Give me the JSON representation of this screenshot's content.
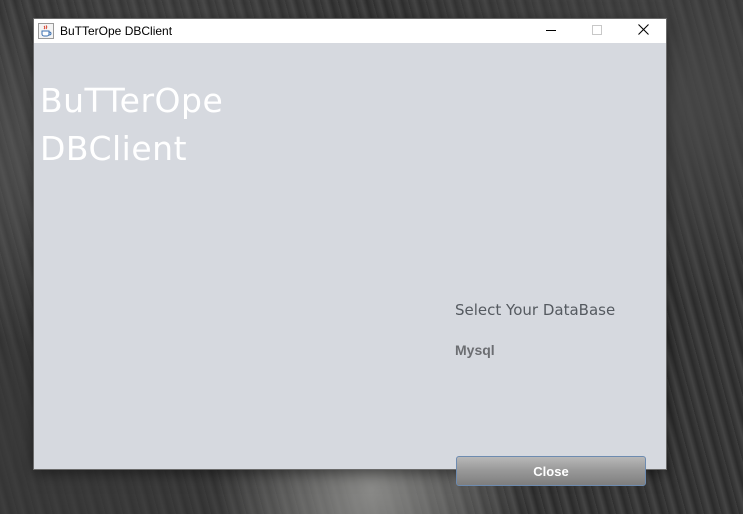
{
  "window": {
    "title": "BuTTerOpe DBClient",
    "icon": "java-cup-icon"
  },
  "controls": {
    "minimize_icon": "minimize-icon",
    "maximize_icon": "maximize-icon",
    "close_icon": "close-icon"
  },
  "main": {
    "title_line1": "BuTTerOpe",
    "title_line2": "DBClient",
    "select_label": "Select Your DataBase",
    "databases": [
      "Mysql"
    ],
    "close_label": "Close"
  },
  "colors": {
    "window_bg": "#d6d9df",
    "title_text": "#ffffff",
    "button_border": "#6d8bb0"
  }
}
